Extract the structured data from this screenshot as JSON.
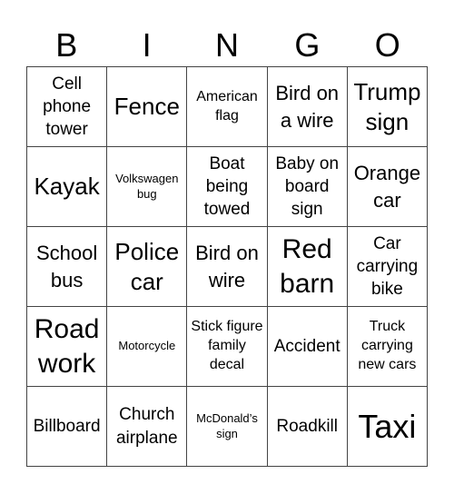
{
  "header": {
    "letters": [
      "B",
      "I",
      "N",
      "G",
      "O"
    ]
  },
  "cells": [
    {
      "text": "Cell phone tower",
      "size": "m"
    },
    {
      "text": "Fence",
      "size": "xl"
    },
    {
      "text": "American flag",
      "size": "s"
    },
    {
      "text": "Bird on a wire",
      "size": "l"
    },
    {
      "text": "Trump sign",
      "size": "xl"
    },
    {
      "text": "Kayak",
      "size": "xl"
    },
    {
      "text": "Volkswagen bug",
      "size": "xs"
    },
    {
      "text": "Boat being towed",
      "size": "m"
    },
    {
      "text": "Baby on board sign",
      "size": "m"
    },
    {
      "text": "Orange car",
      "size": "l"
    },
    {
      "text": "School bus",
      "size": "l"
    },
    {
      "text": "Police car",
      "size": "xl"
    },
    {
      "text": "Bird on wire",
      "size": "l"
    },
    {
      "text": "Red barn",
      "size": "xxl"
    },
    {
      "text": "Car carrying bike",
      "size": "m"
    },
    {
      "text": "Road work",
      "size": "xxl"
    },
    {
      "text": "Motorcycle",
      "size": "xs"
    },
    {
      "text": "Stick figure family decal",
      "size": "s"
    },
    {
      "text": "Accident",
      "size": "m"
    },
    {
      "text": "Truck carrying new cars",
      "size": "s"
    },
    {
      "text": "Billboard",
      "size": "m"
    },
    {
      "text": "Church airplane",
      "size": "m"
    },
    {
      "text": "McDonald’s sign",
      "size": "xs"
    },
    {
      "text": "Roadkill",
      "size": "m"
    },
    {
      "text": "Taxi",
      "size": "xxxl"
    }
  ]
}
